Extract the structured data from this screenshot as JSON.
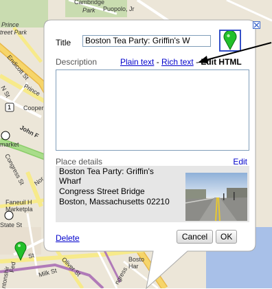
{
  "map": {
    "labels": {
      "cambridge": "Cambridge",
      "park": "Park",
      "puopolo": "Puopolo, Jr",
      "prince": "Prince",
      "street_park": "treet Park",
      "endicott": "Endicott St",
      "prince_st": "Prince",
      "n_st": "N St",
      "route_1": "1",
      "cooper": "Cooper",
      "market": "market",
      "john_f": "John F",
      "congress": "Congress St",
      "nor": "Nor",
      "faneuil": "Faneuil H",
      "marketplace": "Marketpla",
      "state_st": "State St",
      "milk_st": "Milk St",
      "st_bottom": "St",
      "oliver": "Oliver St",
      "boston_harbor": "Bosto",
      "harbor": "Har",
      "fed": "Fed",
      "devonshire": "ntonshir",
      "ngress": "ngress"
    }
  },
  "infowindow": {
    "title_label": "Title",
    "title_value": "Boston Tea Party: Griffin's W",
    "description_label": "Description",
    "plain_text_link": "Plain text",
    "rich_text_link": "Rich text",
    "separator": "-",
    "edit_html": "Edit HTML",
    "description_value": "",
    "place_details_label": "Place details",
    "place_edit_link": "Edit",
    "place_lines": [
      "Boston Tea Party: Griffin's",
      "Wharf",
      "Congress Street Bridge",
      "Boston, Massachusetts 02210"
    ],
    "delete_link": "Delete",
    "cancel_button": "Cancel",
    "ok_button": "OK",
    "close_icon": "close-icon",
    "marker_icon": "green-placemark-icon"
  },
  "colors": {
    "link": "#0000cc",
    "marker": "#22c02a",
    "marker_picker_border": "#3450c8",
    "map_road_yellow": "#f5e46c",
    "map_highway": "#f0c040"
  }
}
